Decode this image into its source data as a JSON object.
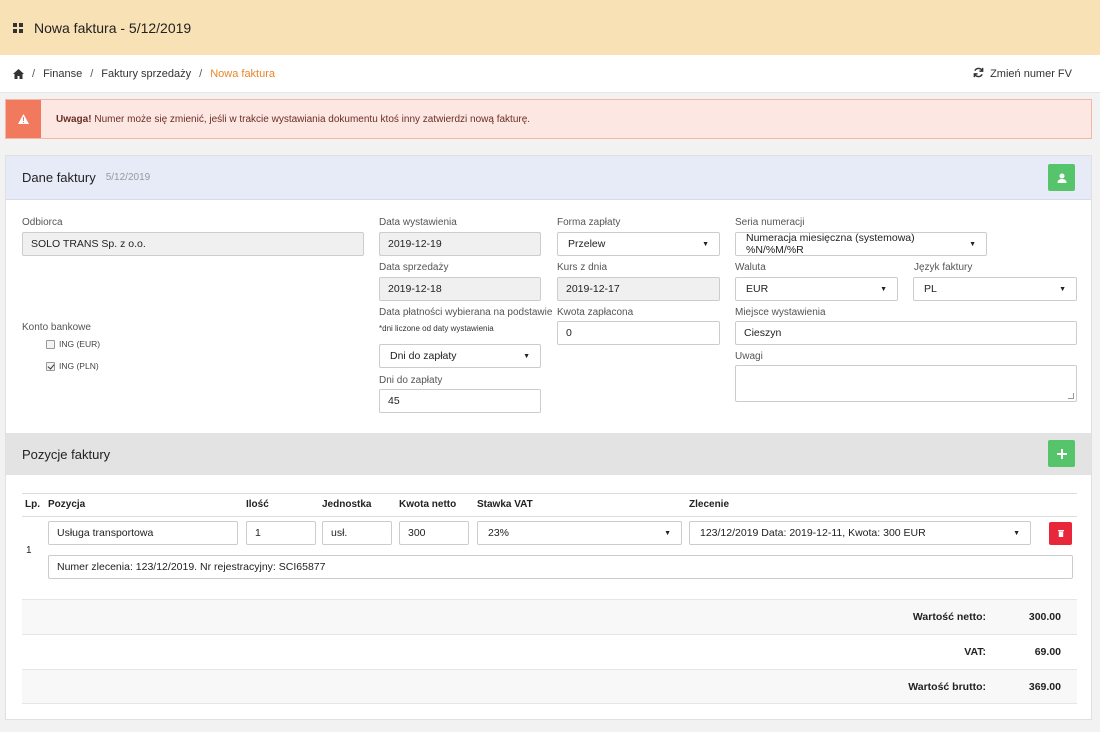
{
  "header": {
    "title": "Nowa faktura - 5/12/2019"
  },
  "breadcrumb": {
    "items": [
      "Finanse",
      "Faktury sprzedaży"
    ],
    "active": "Nowa faktura",
    "separator": "/"
  },
  "actions": {
    "change_number": "Zmień numer FV"
  },
  "alert": {
    "strong": "Uwaga!",
    "text": " Numer może się zmienić, jeśli w trakcie wystawiania dokumentu ktoś inny zatwierdzi nową fakturę."
  },
  "invoice_section": {
    "title": "Dane faktury",
    "subtitle": "5/12/2019",
    "recipient_label": "Odbiorca",
    "recipient_value": "SOLO TRANS Sp. z o.o.",
    "bank_label": "Konto bankowe",
    "banks": [
      {
        "label": "ING (EUR)",
        "checked": false
      },
      {
        "label": "ING (PLN)",
        "checked": true
      }
    ],
    "issue_date_label": "Data wystawienia",
    "issue_date_value": "2019-12-19",
    "sale_date_label": "Data sprzedaży",
    "sale_date_value": "2019-12-18",
    "payment_basis_label": "Data płatności wybierana na podstawie",
    "payment_basis_note": "*dni liczone od daty wystawienia",
    "payment_basis_value": "Dni do zapłaty",
    "days_label": "Dni do zapłaty",
    "days_value": "45",
    "payment_form_label": "Forma zapłaty",
    "payment_form_value": "Przelew",
    "rate_date_label": "Kurs z dnia",
    "rate_date_value": "2019-12-17",
    "paid_label": "Kwota zapłacona",
    "paid_value": "0",
    "series_label": "Seria numeracji",
    "series_value": "Numeracja miesięczna (systemowa) %N/%M/%R",
    "currency_label": "Waluta",
    "currency_value": "EUR",
    "language_label": "Język faktury",
    "language_value": "PL",
    "place_label": "Miejsce wystawienia",
    "place_value": "Cieszyn",
    "notes_label": "Uwagi"
  },
  "items_section": {
    "title": "Pozycje faktury",
    "columns": {
      "lp": "Lp.",
      "position": "Pozycja",
      "qty": "Ilość",
      "unit": "Jednostka",
      "net": "Kwota netto",
      "vat": "Stawka VAT",
      "order": "Zlecenie"
    },
    "rows": [
      {
        "lp": "1",
        "position": "Usługa transportowa",
        "qty": "1",
        "unit": "usł.",
        "net": "300",
        "vat": "23%",
        "order": "123/12/2019 Data: 2019-12-11, Kwota: 300 EUR",
        "description": "Numer zlecenia: 123/12/2019. Nr rejestracyjny: SCI65877"
      }
    ],
    "totals": [
      {
        "label": "Wartość netto:",
        "value": "300.00"
      },
      {
        "label": "VAT:",
        "value": "69.00"
      },
      {
        "label": "Wartość brutto:",
        "value": "369.00"
      }
    ]
  },
  "colors": {
    "topbar": "#f8e1b4",
    "accent": "#e8862a",
    "green": "#56c46b",
    "red": "#e8283a",
    "alert_icon": "#f1795e"
  }
}
